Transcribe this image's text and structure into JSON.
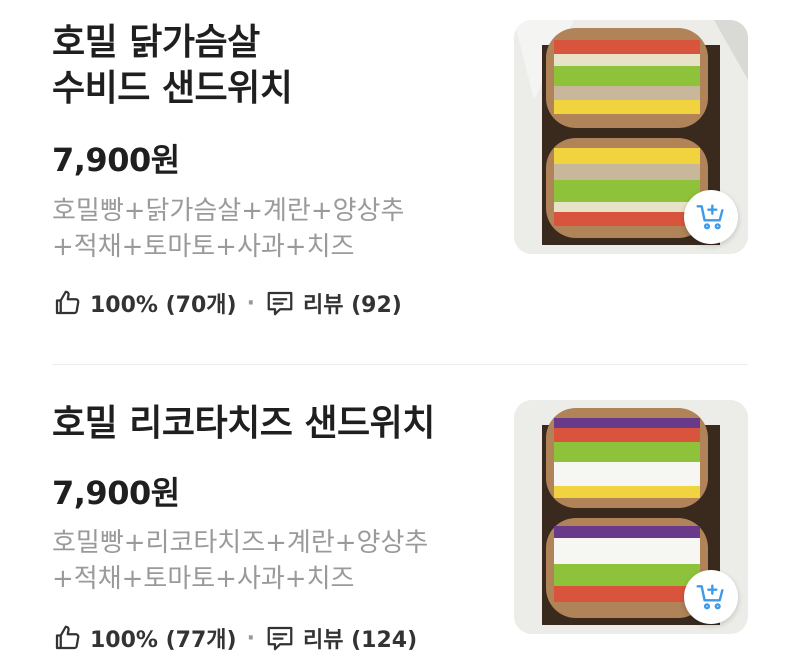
{
  "products": [
    {
      "name": "호밀 닭가슴살\n수비드 샌드위치",
      "price": "7,900원",
      "ingredients": "호밀빵+닭가슴살+계란+양상추\n+적채+토마토+사과+치즈",
      "like_rate": "100% (70개)",
      "reviews": "리뷰 (92)"
    },
    {
      "name": "호밀 리코타치즈 샌드위치",
      "price": "7,900원",
      "ingredients": "호밀빵+리코타치즈+계란+양상추\n+적채+토마토+사과+치즈",
      "like_rate": "100% (77개)",
      "reviews": "리뷰 (124)"
    }
  ],
  "icons": {
    "like": "thumbs-up-icon",
    "review": "speech-bubble-icon",
    "cart": "add-to-cart-icon"
  },
  "colors": {
    "accent": "#3d9be9",
    "muted_text": "#9a9a9a"
  }
}
